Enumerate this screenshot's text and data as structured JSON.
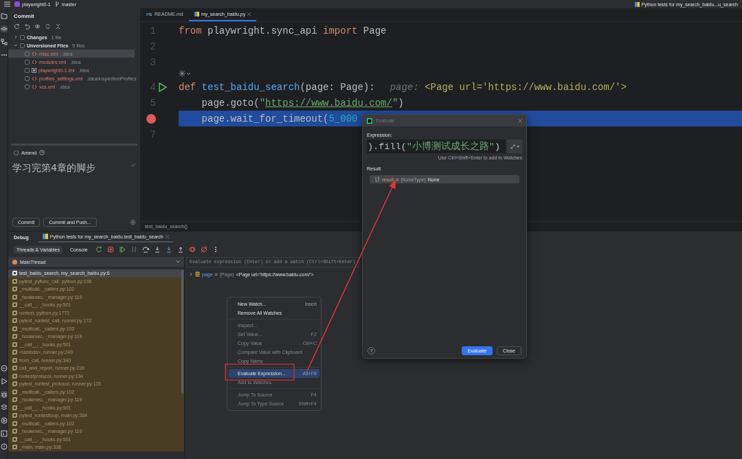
{
  "top_bar": {
    "project": "playwright0-1",
    "branch": "master",
    "run_config": "Python tests for my_search_baidu...u_search"
  },
  "commit_panel": {
    "title": "Commit",
    "tree": [
      {
        "label": "Changes",
        "count": "1 file",
        "expanded": false,
        "checked": false
      },
      {
        "label": "Unversioned Files",
        "count": "5 files",
        "expanded": true,
        "checked": false,
        "children": [
          {
            "name": "misc.xml",
            "location": ".idea",
            "selected": true,
            "checked": false,
            "kind": "xml"
          },
          {
            "name": "modules.xml",
            "location": ".idea",
            "selected": false,
            "checked": false,
            "kind": "xml"
          },
          {
            "name": "playwright0-1.iml",
            "location": ".idea",
            "selected": false,
            "checked": false,
            "kind": "module"
          },
          {
            "name": "profiles_settings.xml",
            "location": ".idea\\inspectionProfiles",
            "selected": false,
            "checked": false,
            "kind": "xml"
          },
          {
            "name": "vcs.xml",
            "location": ".idea",
            "selected": false,
            "checked": false,
            "kind": "xml"
          }
        ]
      }
    ],
    "amend": {
      "label": "Amend",
      "checked": false
    },
    "message": "学习完第4章的脚步",
    "buttons": [
      "Commit",
      "Commit and Push..."
    ]
  },
  "editor": {
    "tabs": [
      {
        "label": "README.md",
        "selected": false,
        "kind": "markdown"
      },
      {
        "label": "my_search_baidu.py",
        "selected": true,
        "kind": "python"
      }
    ],
    "lines": [
      {
        "number": "1",
        "run_marker": false,
        "breakpoint": false,
        "current": false,
        "inlay_icon": false,
        "tokens": [
          {
            "text": "from",
            "kind": "keyword"
          },
          {
            "text": " playwright.sync_api ",
            "kind": "plain"
          },
          {
            "text": "import",
            "kind": "keyword"
          },
          {
            "text": " Page",
            "kind": "plain"
          }
        ]
      },
      {
        "number": "2",
        "run_marker": false,
        "breakpoint": false,
        "current": false,
        "inlay_icon": false
      },
      {
        "number": "3",
        "run_marker": false,
        "breakpoint": false,
        "current": false,
        "inlay_icon": false
      },
      {
        "number": "4",
        "run_marker": true,
        "breakpoint": false,
        "current": false,
        "inlay_icon": true,
        "tokens": [
          {
            "text": "def ",
            "kind": "keyword"
          },
          {
            "text": "test_baidu_search",
            "kind": "func"
          },
          {
            "text": "(page: Page):",
            "kind": "plain"
          }
        ],
        "hint": {
          "name": "page:",
          "value": "<Page url='https://www.baidu.com/'>"
        }
      },
      {
        "number": "5",
        "run_marker": false,
        "breakpoint": false,
        "current": false,
        "inlay_icon": false,
        "tokens": [
          {
            "text": "    page.goto(",
            "kind": "plain"
          },
          {
            "text": "\"",
            "kind": "string"
          },
          {
            "text": "https://www.baidu.com/",
            "kind": "link"
          },
          {
            "text": "\"",
            "kind": "string"
          },
          {
            "text": ")",
            "kind": "plain"
          }
        ]
      },
      {
        "run_marker": false,
        "breakpoint": true,
        "current": true,
        "inlay_icon": false,
        "tokens": [
          {
            "text": "    page.wait_for_timeout(",
            "kind": "plain"
          },
          {
            "text": "5_000",
            "kind": "number"
          }
        ]
      },
      {
        "number": "7",
        "run_marker": false,
        "breakpoint": false,
        "current": false,
        "inlay_icon": false
      }
    ],
    "breadcrumb": "test_baidu_search()"
  },
  "debug": {
    "title": "Debug",
    "session_tab": "Python tests for my_search_baidu.test_baidu_search",
    "subtabs": [
      {
        "label": "Threads & Variables",
        "selected": true
      },
      {
        "label": "Console",
        "selected": false
      }
    ],
    "thread": "MainThread",
    "frames": [
      {
        "label": "test_baidu_search, my_search_baidu.py:6",
        "kind": "user",
        "selected": true
      },
      {
        "label": "pytest_pyfunc_call, python.py:195",
        "kind": "library",
        "selected": false
      },
      {
        "label": "_multicall, _callers.py:102",
        "kind": "library",
        "selected": false
      },
      {
        "label": "_hookexec, _manager.py:119",
        "kind": "library",
        "selected": false
      },
      {
        "label": "__call__, _hooks.py:501",
        "kind": "library",
        "selected": false
      },
      {
        "label": "runtest, python.py:1772",
        "kind": "library",
        "selected": false
      },
      {
        "label": "pytest_runtest_call, runner.py:172",
        "kind": "library",
        "selected": false
      },
      {
        "label": "_multicall, _callers.py:102",
        "kind": "library",
        "selected": false
      },
      {
        "label": "_hookexec, _manager.py:119",
        "kind": "library",
        "selected": false
      },
      {
        "label": "__call__, _hooks.py:501",
        "kind": "library",
        "selected": false
      },
      {
        "label": "<lambda>, runner.py:249",
        "kind": "library",
        "selected": false
      },
      {
        "label": "from_call, runner.py:340",
        "kind": "library",
        "selected": false
      },
      {
        "label": "call_and_report, runner.py:239",
        "kind": "library",
        "selected": false
      },
      {
        "label": "runtestprotocol, runner.py:134",
        "kind": "library",
        "selected": false
      },
      {
        "label": "pytest_runtest_protocol, runner.py:115",
        "kind": "library",
        "selected": false
      },
      {
        "label": "_multicall, _callers.py:102",
        "kind": "library",
        "selected": false
      },
      {
        "label": "_hookexec, _manager.py:119",
        "kind": "library",
        "selected": false
      },
      {
        "label": "__call__, _hooks.py:501",
        "kind": "library",
        "selected": false
      },
      {
        "label": "pytest_runtestloop, main.py:364",
        "kind": "library",
        "selected": false
      },
      {
        "label": "_multicall, _callers.py:102",
        "kind": "library",
        "selected": false
      },
      {
        "label": "_hookexec, _manager.py:119",
        "kind": "library",
        "selected": false
      },
      {
        "label": "__call__, _hooks.py:501",
        "kind": "library",
        "selected": false
      },
      {
        "label": "_main, main.py:338",
        "kind": "library",
        "selected": false
      }
    ],
    "evaluate_placeholder": "Evaluate expression (Enter) or add a watch (Ctrl+Shift+Enter)",
    "variables": [
      {
        "name": "page",
        "operator": "=",
        "type": "{Page}",
        "value": "<Page url='https://www.baidu.com/'>",
        "expanded": false
      }
    ]
  },
  "context_menu": {
    "items": [
      {
        "kind": "item",
        "label": "New Watch...",
        "shortcut": "Insert",
        "disabled": false,
        "selected": false
      },
      {
        "kind": "item",
        "label": "Remove All Watches",
        "disabled": false,
        "selected": false
      },
      {
        "kind": "separator"
      },
      {
        "kind": "item",
        "label": "Inspect...",
        "disabled": true,
        "selected": false
      },
      {
        "kind": "item",
        "label": "Set Value...",
        "shortcut": "F2",
        "disabled": true,
        "selected": false
      },
      {
        "kind": "item",
        "label": "Copy Value",
        "shortcut": "Ctrl+C",
        "disabled": true,
        "selected": false
      },
      {
        "kind": "item",
        "label": "Compare Value with Clipboard",
        "disabled": true,
        "selected": false
      },
      {
        "kind": "item",
        "label": "Copy Name",
        "disabled": true,
        "selected": false
      },
      {
        "kind": "separator"
      },
      {
        "kind": "item",
        "label": "Evaluate Expression...",
        "shortcut": "Alt+F8",
        "disabled": false,
        "selected": true
      },
      {
        "kind": "item",
        "label": "Add to Watches",
        "disabled": true,
        "selected": false
      },
      {
        "kind": "separator"
      },
      {
        "kind": "item",
        "label": "Jump To Source",
        "shortcut": "F4",
        "disabled": true,
        "selected": false
      },
      {
        "kind": "item",
        "label": "Jump To Type Source",
        "shortcut": "Shift+F4",
        "disabled": true,
        "selected": false
      }
    ]
  },
  "evaluate_dialog": {
    "title": "Evaluate",
    "expression_label": "Expression:",
    "expression": [
      {
        "text": ").fill(",
        "kind": "plain"
      },
      {
        "text": "\"小博测试成长之路\"",
        "kind": "string"
      },
      {
        "text": ")",
        "kind": "plain"
      }
    ],
    "hint": "Use Ctrl+Shift+Enter to add to Watches",
    "result_label": "Result:",
    "result": {
      "name": "result",
      "operator": "=",
      "type": "{NoneType}",
      "value": "None"
    },
    "help": "?",
    "buttons": [
      {
        "label": "Evaluate",
        "primary": true
      },
      {
        "label": "Close",
        "primary": false
      }
    ]
  }
}
